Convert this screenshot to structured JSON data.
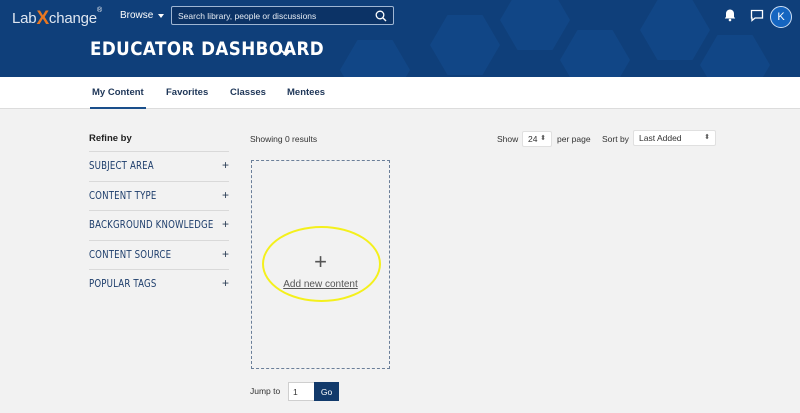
{
  "header": {
    "logo_lab": "Lab",
    "logo_x": "X",
    "logo_change": "change",
    "logo_tm": "®",
    "browse_label": "Browse",
    "search_placeholder": "Search library, people or discussions",
    "avatar_initial": "K",
    "dashboard_title": "EDUCATOR DASHBOARD"
  },
  "tabs": [
    {
      "label": "My Content",
      "active": true
    },
    {
      "label": "Favorites",
      "active": false
    },
    {
      "label": "Classes",
      "active": false
    },
    {
      "label": "Mentees",
      "active": false
    }
  ],
  "sidebar": {
    "title": "Refine by",
    "filters": [
      {
        "label": "SUBJECT AREA"
      },
      {
        "label": "CONTENT TYPE"
      },
      {
        "label": "BACKGROUND KNOWLEDGE"
      },
      {
        "label": "CONTENT SOURCE"
      },
      {
        "label": "POPULAR TAGS"
      }
    ],
    "expand_symbol": "+"
  },
  "results": {
    "showing_text": "Showing 0 results",
    "show_label": "Show",
    "per_page_value": "24",
    "per_page_label": "per page",
    "sort_label": "Sort by",
    "sort_value": "Last Added"
  },
  "add_card": {
    "plus": "+",
    "link_label": "Add new content"
  },
  "pagination": {
    "jump_label": "Jump to",
    "page_value": "1",
    "go_label": "Go"
  },
  "colors": {
    "header_bg": "#0f3f7a",
    "accent": "#e87722",
    "highlight": "#f4f01c"
  }
}
